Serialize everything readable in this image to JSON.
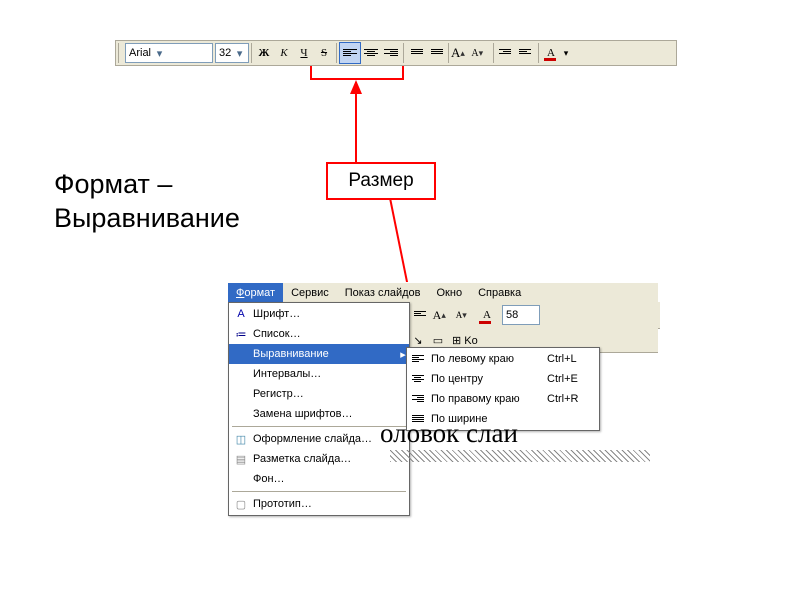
{
  "toolbar": {
    "font_name": "Arial",
    "font_size": "32",
    "bold": "Ж",
    "italic": "К",
    "underline": "Ч",
    "strike": "S",
    "bigger": "A",
    "smaller": "A",
    "font_color_label": "A"
  },
  "callout_label": "Размер",
  "heading_line1": "Формат –",
  "heading_line2": "Выравнивание",
  "menubar": {
    "format": "Формат",
    "service": "Сервис",
    "slideshow": "Показ слайдов",
    "window": "Окно",
    "help": "Справка"
  },
  "under": {
    "zoom": "58"
  },
  "dropdown": {
    "font": "Шрифт…",
    "list": "Список…",
    "alignment": "Выравнивание",
    "intervals": "Интервалы…",
    "register": "Регистр…",
    "replace_fonts": "Замена шрифтов…",
    "slide_design": "Оформление слайда…",
    "slide_layout": "Разметка слайда…",
    "background": "Фон…",
    "prototype": "Прототип…"
  },
  "submenu": {
    "left": "По левому краю",
    "left_sc": "Ctrl+L",
    "center": "По центру",
    "center_sc": "Ctrl+E",
    "right": "По правому краю",
    "right_sc": "Ctrl+R",
    "justify": "По ширине"
  },
  "behind_text": "оловок слаи"
}
